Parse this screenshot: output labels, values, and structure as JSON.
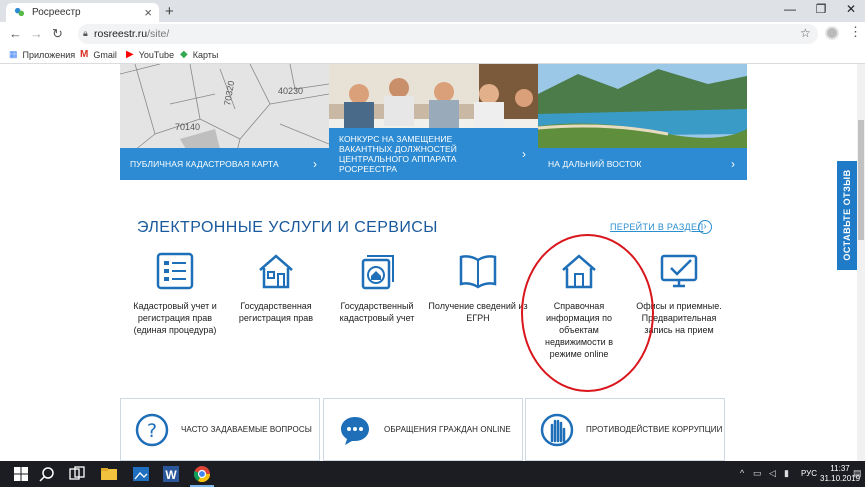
{
  "browser": {
    "tab_title": "Росреестр",
    "new_tab": "+",
    "url_host": "rosreestr.ru",
    "url_path": "/site/",
    "controls": {
      "minimize": "—",
      "maximize": "❐",
      "close": "✕"
    },
    "bookmarks": [
      {
        "label": "Приложения",
        "icon": "apps-grid-icon"
      },
      {
        "label": "Gmail",
        "icon": "gmail-icon"
      },
      {
        "label": "YouTube",
        "icon": "youtube-icon"
      },
      {
        "label": "Карты",
        "icon": "maps-icon"
      }
    ]
  },
  "cards": [
    {
      "label": "Публичная кадастровая карта",
      "map_numbers": [
        "70140",
        "40230",
        "70320"
      ]
    },
    {
      "label": "Конкурс на замещение вакантных должностей центрального аппарата Росреестра"
    },
    {
      "label": "На Дальний Восток"
    }
  ],
  "section": {
    "title": "ЭЛЕКТРОННЫЕ УСЛУГИ И СЕРВИСЫ",
    "link": "ПЕРЕЙТИ В РАЗДЕЛ",
    "arrow": "›"
  },
  "services": [
    {
      "label": "Кадастровый учет и регистрация прав (единая процедура)",
      "icon": "form-document-icon"
    },
    {
      "label": "Государственная регистрация прав",
      "icon": "house-icon"
    },
    {
      "label": "Государственный кадастровый учет",
      "icon": "house-stamp-icon"
    },
    {
      "label": "Получение сведений из ЕГРН",
      "icon": "open-book-icon"
    },
    {
      "label": "Справочная информация по объектам недвижимости в режиме online",
      "icon": "house-icon"
    },
    {
      "label": "Офисы и приемные. Предварительная запись на прием",
      "icon": "monitor-check-icon"
    }
  ],
  "bottom_boxes": [
    {
      "label": "Часто задаваемые вопросы",
      "icon": "question-icon"
    },
    {
      "label": "Обращения граждан online",
      "icon": "chat-bubble-icon"
    },
    {
      "label": "Противодействие коррупции",
      "icon": "hand-stop-icon"
    }
  ],
  "feedback_tab": "ОСТАВЬТЕ ОТЗЫВ",
  "taskbar": {
    "language": "РУС",
    "time": "11:37",
    "date": "31.10.2019"
  },
  "colors": {
    "brand_blue": "#2c8bd2",
    "title_blue": "#1a5a9c",
    "annotation_red": "#d9161c"
  }
}
